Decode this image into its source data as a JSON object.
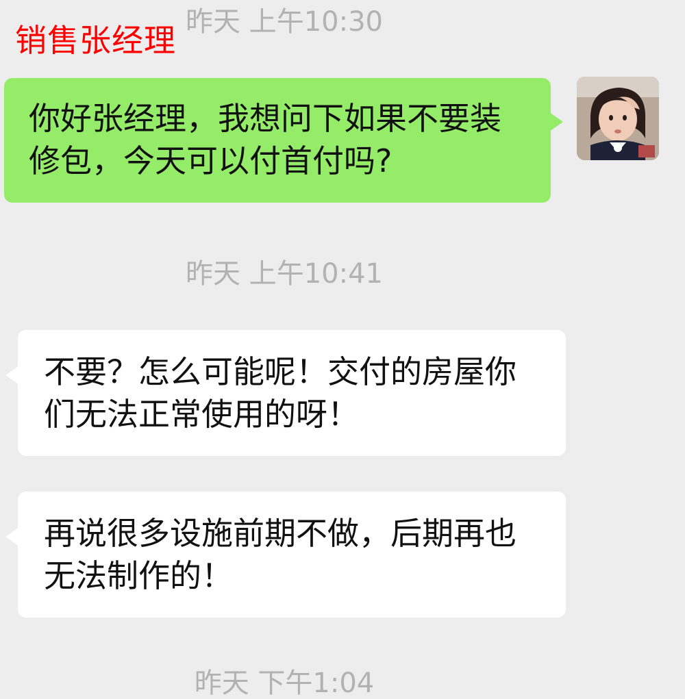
{
  "chat": {
    "contact_label": "销售张经理",
    "timestamps": [
      "昨天 上午10:30",
      "昨天 上午10:41",
      "昨天 下午1:04"
    ],
    "messages": [
      {
        "side": "outgoing",
        "text": "你好张经理，我想问下如果不要装修包，今天可以付首付吗?"
      },
      {
        "side": "incoming",
        "text": "不要？怎么可能呢！交付的房屋你们无法正常使用的呀！"
      },
      {
        "side": "incoming",
        "text": "再说很多设施前期不做，后期再也无法制作的！"
      }
    ]
  },
  "colors": {
    "background": "#ededed",
    "outgoing_bubble": "#95ec69",
    "incoming_bubble": "#ffffff",
    "timestamp_text": "#b2b2b2",
    "contact_label": "#ff0000"
  },
  "icons": {
    "avatar": "user-avatar-photo"
  }
}
